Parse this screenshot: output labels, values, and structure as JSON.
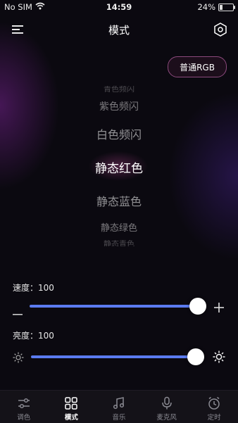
{
  "status_bar": {
    "carrier": "No SIM",
    "time": "14:59",
    "battery_percent": "24%",
    "battery_level": 0.24
  },
  "nav": {
    "title": "模式"
  },
  "mode_chip": {
    "label": "普通RGB"
  },
  "picker": {
    "items": [
      "青色频闪",
      "紫色频闪",
      "白色频闪",
      "静态红色",
      "静态蓝色",
      "静态绿色",
      "静态青色"
    ],
    "selected_index": 3
  },
  "speed": {
    "label": "速度：",
    "value": "100",
    "level": 1.0
  },
  "brightness": {
    "label": "亮度：",
    "value": "100",
    "level": 1.0
  },
  "colors": {
    "accent": "#5b7bf0",
    "chip_border": "#8d4a7e",
    "background": "#0b0910"
  },
  "tabs": [
    {
      "label": "调色",
      "icon": "sliders-icon",
      "active": false
    },
    {
      "label": "模式",
      "icon": "grid-icon",
      "active": true
    },
    {
      "label": "音乐",
      "icon": "music-note-icon",
      "active": false
    },
    {
      "label": "麦克风",
      "icon": "microphone-icon",
      "active": false
    },
    {
      "label": "定时",
      "icon": "alarm-clock-icon",
      "active": false
    }
  ]
}
